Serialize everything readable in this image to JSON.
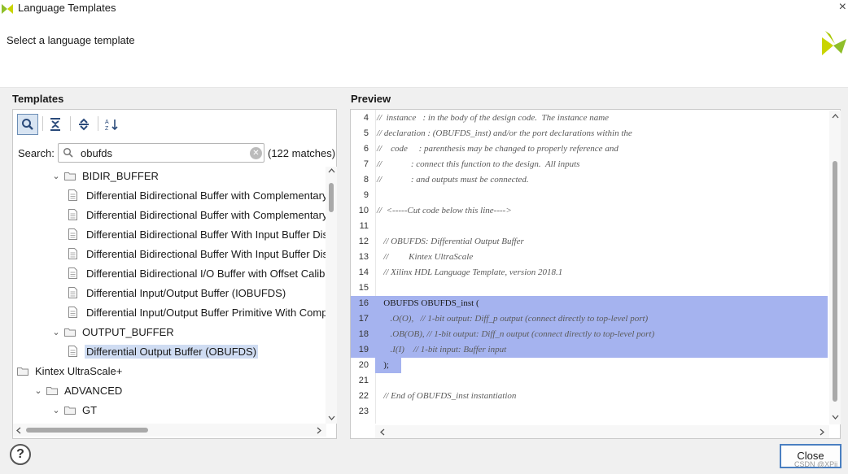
{
  "window": {
    "title": "Language Templates",
    "close_glyph": "×"
  },
  "header": {
    "subtitle": "Select a language template"
  },
  "templates": {
    "label": "Templates",
    "search_label": "Search:",
    "search_value": "obufds",
    "match_count": "(122 matches)",
    "tree": [
      {
        "indent": 1,
        "kind": "folder",
        "expanded": true,
        "label": "BIDIR_BUFFER"
      },
      {
        "indent": 2,
        "kind": "file",
        "label": "Differential Bidirectional Buffer with Complementary Ou"
      },
      {
        "indent": 2,
        "kind": "file",
        "label": "Differential Bidirectional Buffer with Complementary Ou"
      },
      {
        "indent": 2,
        "kind": "file",
        "label": "Differential Bidirectional Buffer With Input Buffer Disable"
      },
      {
        "indent": 2,
        "kind": "file",
        "label": "Differential Bidirectional Buffer With Input Buffer Disable"
      },
      {
        "indent": 2,
        "kind": "file",
        "label": "Differential Bidirectional I/O Buffer with Offset Calibratio"
      },
      {
        "indent": 2,
        "kind": "file",
        "label": "Differential Input/Output Buffer (IOBUFDS)"
      },
      {
        "indent": 2,
        "kind": "file",
        "label": "Differential Input/Output Buffer Primitive With Compleme"
      },
      {
        "indent": 1,
        "kind": "folder",
        "expanded": true,
        "label": "OUTPUT_BUFFER"
      },
      {
        "indent": 2,
        "kind": "file",
        "label": "Differential Output Buffer (OBUFDS)",
        "selected": true
      },
      {
        "indent": -1,
        "kind": "folder",
        "expanded": false,
        "label": "Kintex UltraScale+"
      },
      {
        "indent": 0,
        "kind": "folder",
        "expanded": true,
        "label": "ADVANCED"
      },
      {
        "indent": 1,
        "kind": "folder",
        "expanded": true,
        "label": "GT"
      }
    ]
  },
  "preview": {
    "label": "Preview",
    "lines": [
      {
        "n": "4",
        "text": "//  instance   : in the body of the design code.  The instance name"
      },
      {
        "n": "5",
        "text": "// declaration : (OBUFDS_inst) and/or the port declarations within the"
      },
      {
        "n": "6",
        "text": "//    code     : parenthesis may be changed to properly reference and"
      },
      {
        "n": "7",
        "text": "//             : connect this function to the design.  All inputs"
      },
      {
        "n": "8",
        "text": "//             : and outputs must be connected."
      },
      {
        "n": "9",
        "text": ""
      },
      {
        "n": "10",
        "text": "//  <-----Cut code below this line---->"
      },
      {
        "n": "11",
        "text": ""
      },
      {
        "n": "12",
        "text": "   // OBUFDS: Differential Output Buffer"
      },
      {
        "n": "13",
        "text": "   //         Kintex UltraScale"
      },
      {
        "n": "14",
        "text": "   // Xilinx HDL Language Template, version 2018.1"
      },
      {
        "n": "15",
        "text": ""
      },
      {
        "n": "16",
        "text": "   OBUFDS OBUFDS_inst (",
        "plain": true,
        "highlight": "full"
      },
      {
        "n": "17",
        "text": "      .O(O),   // 1-bit output: Diff_p output (connect directly to top-level port)",
        "highlight": "full"
      },
      {
        "n": "18",
        "text": "      .OB(OB), // 1-bit output: Diff_n output (connect directly to top-level port)",
        "highlight": "full"
      },
      {
        "n": "19",
        "text": "      .I(I)    // 1-bit input: Buffer input",
        "highlight": "full"
      },
      {
        "n": "20",
        "text": "   );",
        "plain": true,
        "highlight": "partial"
      },
      {
        "n": "21",
        "text": ""
      },
      {
        "n": "22",
        "text": "   // End of OBUFDS_inst instantiation"
      },
      {
        "n": "23",
        "text": ""
      }
    ]
  },
  "footer": {
    "help_glyph": "?",
    "close_label": "Close",
    "watermark": "CSDN @XPii"
  },
  "colors": {
    "accent": "#4a7fc1",
    "highlight": "#a5b3ef",
    "selection": "#cfdcf2"
  }
}
